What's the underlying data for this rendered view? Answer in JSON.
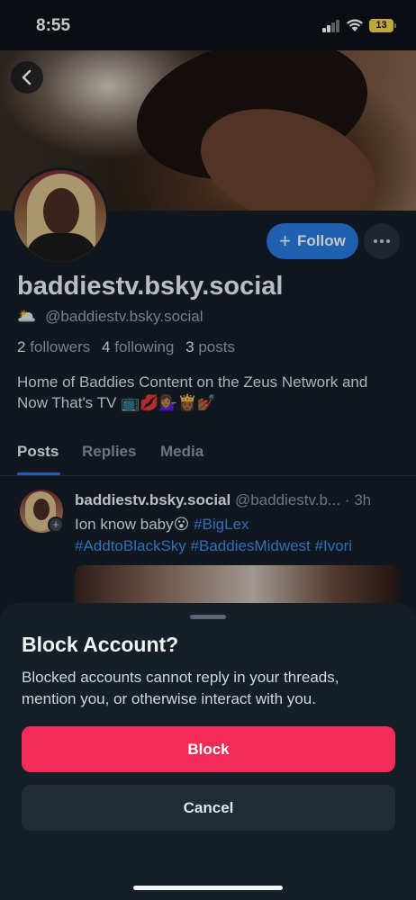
{
  "status_bar": {
    "time": "8:55",
    "battery": "13"
  },
  "profile": {
    "display_name": "baddiestv.bsky.social",
    "handle_emoji": "🌥️",
    "handle": "@baddiestv.bsky.social",
    "followers_count": "2",
    "followers_label": "followers",
    "following_count": "4",
    "following_label": "following",
    "posts_count": "3",
    "posts_label": "posts",
    "bio": "Home of Baddies Content on the Zeus Network and Now That's TV 📺💋💁🏽‍♀️👸🏾💅🏾",
    "follow_label": "Follow"
  },
  "tabs": [
    {
      "label": "Posts",
      "active": true
    },
    {
      "label": "Replies",
      "active": false
    },
    {
      "label": "Media",
      "active": false
    }
  ],
  "post": {
    "author": "baddiestv.bsky.social",
    "handle_time": "@baddiestv.b... · 3h",
    "text": "Ion know baby😮",
    "tags": [
      "#BigLex",
      "#AddtoBlackSky",
      "#BaddiesMidwest",
      "#Ivori"
    ]
  },
  "sheet": {
    "title": "Block Account?",
    "description": "Blocked accounts cannot reply in your threads, mention you, or otherwise interact with you.",
    "block_label": "Block",
    "cancel_label": "Cancel"
  },
  "colors": {
    "background": "#161e27",
    "accent_blue": "#2a7be2",
    "block_red": "#f12c56",
    "link": "#3a8ff0"
  }
}
